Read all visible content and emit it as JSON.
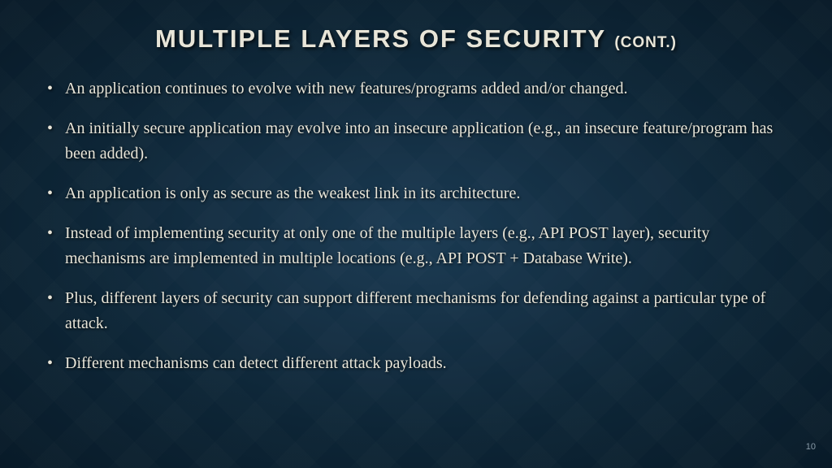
{
  "slide": {
    "title_main": "MULTIPLE LAYERS OF SECURITY",
    "title_suffix": "(CONT.)",
    "bullets": [
      "An application continues to evolve with new features/programs added and/or changed.",
      "An initially secure application may evolve into an insecure application (e.g., an insecure feature/program has been added).",
      "An application is only as secure as the weakest link in its architecture.",
      "Instead of implementing security at only one of the multiple layers (e.g., API POST layer), security mechanisms are implemented in multiple locations (e.g., API POST + Database Write).",
      "Plus, different layers of security can support different mechanisms for defending against a particular type of attack.",
      "Different mechanisms can detect different attack payloads."
    ],
    "page_number": "10"
  }
}
